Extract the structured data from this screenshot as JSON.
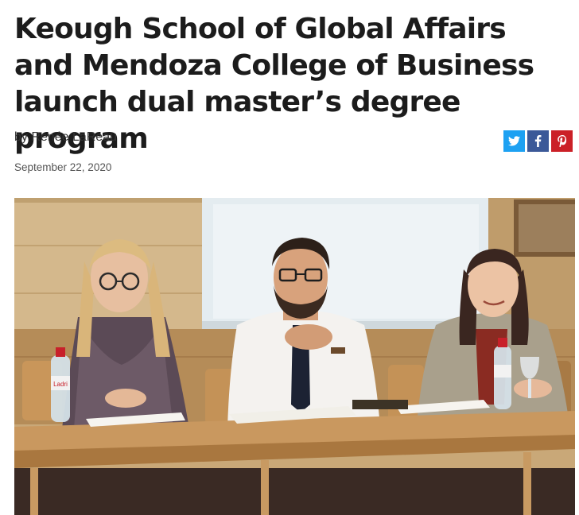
{
  "article": {
    "title": "Keough School of Global Affairs and Mendoza College of Business launch dual master’s degree program",
    "byline": "by Renée LaReau",
    "date": "September 22, 2020"
  },
  "share": {
    "buttons": [
      {
        "name": "twitter",
        "icon": "twitter-icon",
        "color": "#1da1f2"
      },
      {
        "name": "facebook",
        "icon": "facebook-icon",
        "color": "#3b5998"
      },
      {
        "name": "pinterest",
        "icon": "pinterest-icon",
        "color": "#cb2027"
      }
    ]
  },
  "hero_image": {
    "bottle_label": "Ladri"
  }
}
